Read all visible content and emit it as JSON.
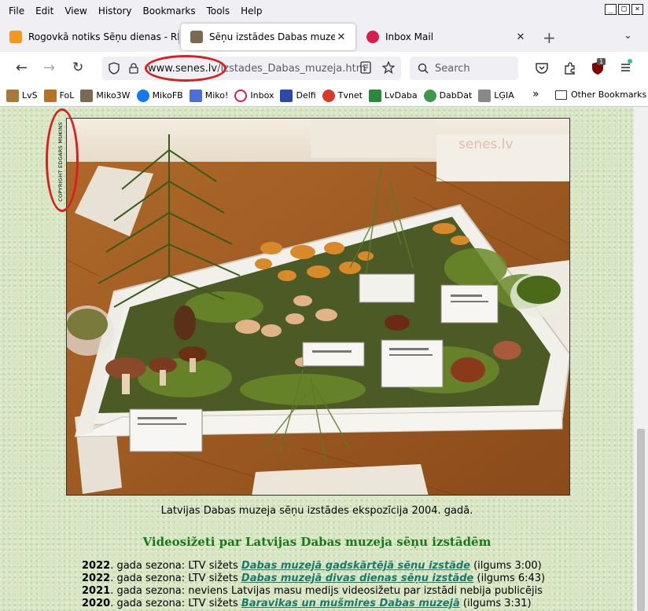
{
  "menu": [
    "File",
    "Edit",
    "View",
    "History",
    "Bookmarks",
    "Tools",
    "Help"
  ],
  "tabs": [
    {
      "title": "Rogovkā notiks Sēņu dienas - RĒZE",
      "favicon_color": "#f39a1e"
    },
    {
      "title": "Sēņu izstādes Dabas muzejā",
      "favicon_color": "#7a6a50"
    },
    {
      "title": "Inbox Mail",
      "favicon_color": "#d6204a"
    }
  ],
  "url": {
    "host": "www.senes.lv",
    "path": "/Izstades_Dabas_muzeja.htm"
  },
  "search": {
    "placeholder": "Search"
  },
  "ublock_badge": "1",
  "bookmarks": [
    {
      "label": "LvS",
      "color": "#a87a3a"
    },
    {
      "label": "FoL",
      "color": "#b3742a"
    },
    {
      "label": "Miko3W",
      "color": "#7a6a55"
    },
    {
      "label": "MikoFB",
      "color": "#1877f2"
    },
    {
      "label": "Miko!",
      "color": "#4a6edb"
    },
    {
      "label": "Inbox",
      "color": "#d6204a"
    },
    {
      "label": "Delfi",
      "color": "#2a4aa8"
    },
    {
      "label": "Tvnet",
      "color": "#d83a2a"
    },
    {
      "label": "LvDaba",
      "color": "#2a8a3a"
    },
    {
      "label": "DabDat",
      "color": "#3a9a4a"
    },
    {
      "label": "LĢIA",
      "color": "#888888"
    }
  ],
  "other_bookmarks": "Other Bookmarks",
  "page": {
    "copyright": "COPYRIGHT EDGARS MUKINS",
    "watermark": "senes.lv",
    "caption": "Latvijas Dabas muzeja sēņu izstādes ekspozīcija 2004. gadā.",
    "heading": "Videosižeti par Latvijas Dabas muzeja sēņu izstādēm",
    "videos": [
      {
        "year": "2022",
        "text": ". gada sezona: LTV sižets ",
        "link": "Dabas muzejā gadskārtējā sēņu izstāde",
        "tail": " (ilgums 3:00)"
      },
      {
        "year": "2022",
        "text": ". gada sezona: LTV sižets ",
        "link": "Dabas muzejā divas dienas sēņu izstāde",
        "tail": " (ilgums 6:43)"
      },
      {
        "year": "2021",
        "text": ". gada sezona: neviens Latvijas masu medijs videosižetu par izstādi nebija publicējis",
        "link": "",
        "tail": ""
      },
      {
        "year": "2020",
        "text": ". gada sezona: LTV sižets ",
        "link": "Baravikas un mušmires Dabas muzejā",
        "tail": " (ilgums 3:31)"
      }
    ]
  },
  "colors": {
    "annotation": "#d82020",
    "heading": "#167a16",
    "link": "#1a7a6a",
    "page_bg": "#d8e6c4"
  }
}
